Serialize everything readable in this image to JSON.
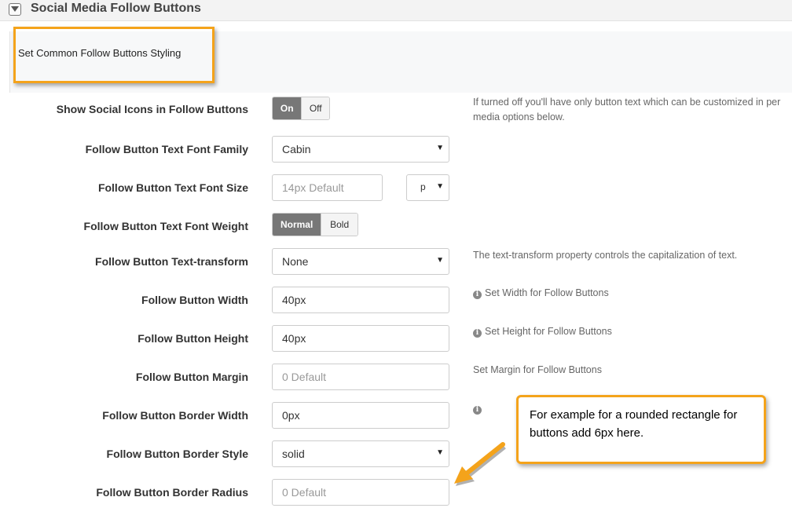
{
  "section": {
    "title": "Social Media Follow Buttons",
    "toggle_icon": "triangle-down-icon"
  },
  "subsection": {
    "title": "Set Common Follow Buttons Styling"
  },
  "rows": {
    "show_icons": {
      "label": "Show Social Icons in Follow Buttons",
      "on": "On",
      "off": "Off",
      "selected": "On",
      "help": "If turned off you'll have only button text which can be customized in per media options below."
    },
    "font_family": {
      "label": "Follow Button Text Font Family",
      "value": "Cabin"
    },
    "font_size": {
      "label": "Follow Button Text Font Size",
      "placeholder": "14px Default",
      "unit": "p"
    },
    "font_weight": {
      "label": "Follow Button Text Font Weight",
      "normal": "Normal",
      "bold": "Bold",
      "selected": "Normal"
    },
    "text_transform": {
      "label": "Follow Button Text-transform",
      "value": "None",
      "help": "The text-transform property controls the capitalization of text."
    },
    "width": {
      "label": "Follow Button Width",
      "value": "40px",
      "help": "Set Width for Follow Buttons"
    },
    "height": {
      "label": "Follow Button Height",
      "value": "40px",
      "help": "Set Height for Follow Buttons"
    },
    "margin": {
      "label": "Follow Button Margin",
      "placeholder": "0 Default",
      "help": "Set Margin for Follow Buttons"
    },
    "border_width": {
      "label": "Follow Button Border Width",
      "value": "0px"
    },
    "border_style": {
      "label": "Follow Button Border Style",
      "value": "solid"
    },
    "border_radius": {
      "label": "Follow Button Border Radius",
      "placeholder": "0 Default"
    }
  },
  "annotation": {
    "text": "For example for a rounded rectangle for buttons add 6px here."
  },
  "colors": {
    "accent": "#f4a31b",
    "toggle_active": "#777777"
  }
}
